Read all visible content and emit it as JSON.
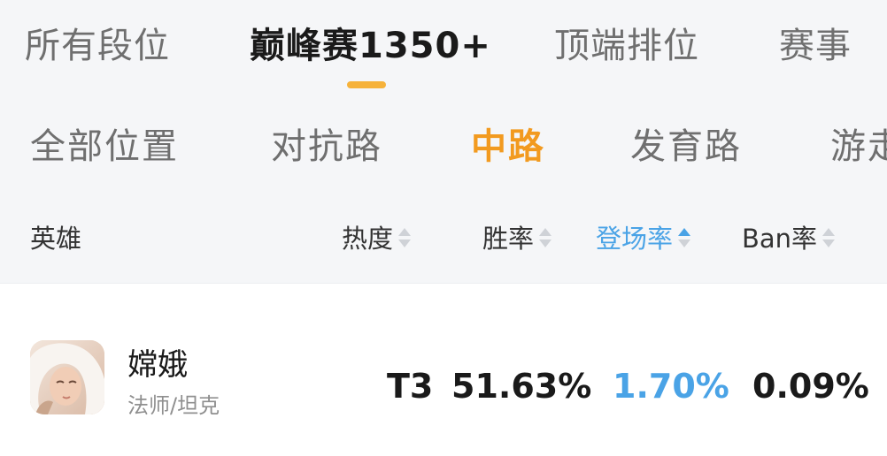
{
  "top_tabs": [
    {
      "label": "所有段位"
    },
    {
      "label": "巅峰赛1350+"
    },
    {
      "label": "顶端排位"
    },
    {
      "label": "赛事"
    }
  ],
  "role_tabs": [
    {
      "label": "全部位置"
    },
    {
      "label": "对抗路"
    },
    {
      "label": "中路"
    },
    {
      "label": "发育路"
    },
    {
      "label": "游走"
    }
  ],
  "table": {
    "columns": [
      {
        "label": "英雄"
      },
      {
        "label": "热度"
      },
      {
        "label": "胜率"
      },
      {
        "label": "登场率"
      },
      {
        "label": "Ban率"
      }
    ],
    "rows": [
      {
        "name": "嫦娥",
        "roles": "法师/坦克",
        "tier": "T3",
        "win_rate": "51.63%",
        "pick_rate": "1.70%",
        "ban_rate": "0.09%"
      }
    ]
  },
  "colors": {
    "accent_orange": "#f29a1f",
    "underline_orange": "#f6b23a",
    "accent_blue": "#4aa3e6",
    "text_dark": "#1a1a1a",
    "text_gray": "#6f6f6f"
  },
  "icons": {
    "sort": "sort-arrows-icon",
    "avatar": "hero-avatar-change"
  }
}
